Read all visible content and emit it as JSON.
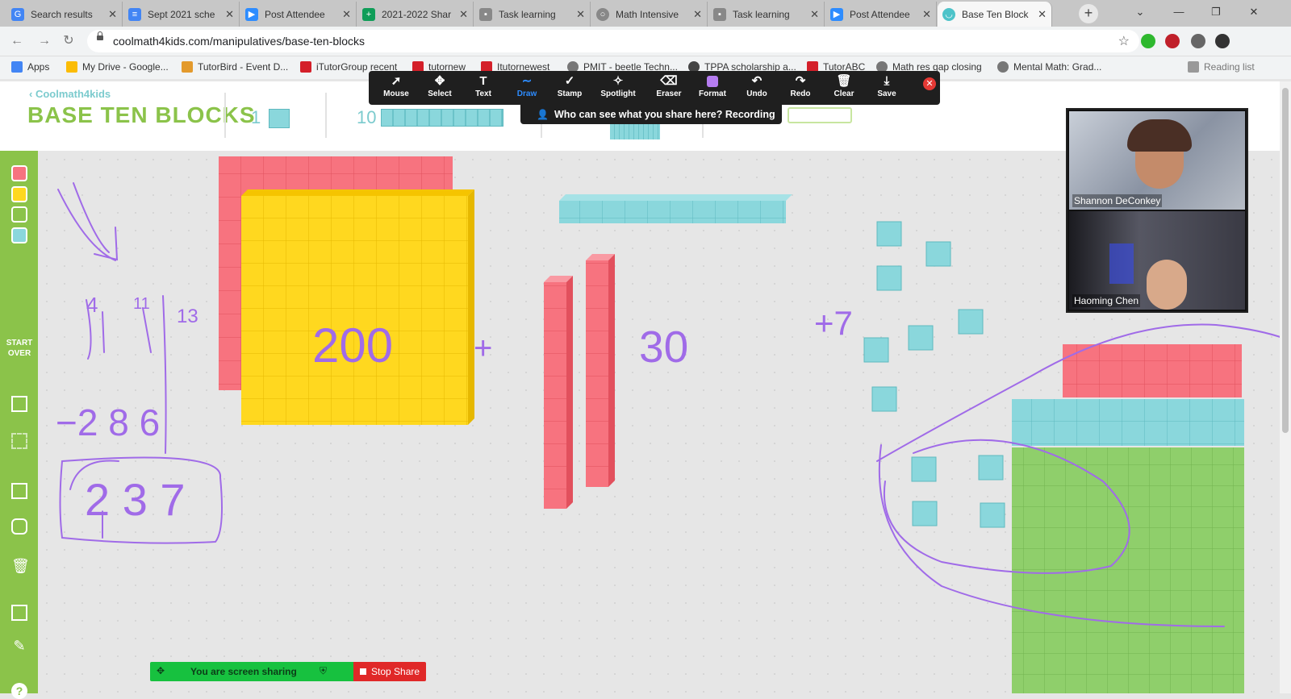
{
  "browser": {
    "tabs": [
      {
        "title": "Search results",
        "icon_color": "#4285f4"
      },
      {
        "title": "Sept 2021 sche",
        "icon_color": "#4285f4"
      },
      {
        "title": "Post Attendee",
        "icon_color": "#2d8cff"
      },
      {
        "title": "2021-2022 Shar",
        "icon_color": "#0f9d58"
      },
      {
        "title": "Task learning",
        "icon_color": "#777777"
      },
      {
        "title": "Math Intensive",
        "icon_color": "#777777"
      },
      {
        "title": "Task learning",
        "icon_color": "#777777"
      },
      {
        "title": "Post Attendee",
        "icon_color": "#2d8cff"
      },
      {
        "title": "Base Ten Block",
        "icon_color": "#4dc3c9"
      }
    ],
    "url": "coolmath4kids.com/manipulatives/base-ten-blocks",
    "bookmarks": [
      "Apps",
      "My Drive - Google...",
      "TutorBird - Event D...",
      "iTutorGroup recent",
      "tutornew",
      "Itutornewest",
      "PMIT - beetle Techn...",
      "TPPA scholarship a...",
      "TutorABC",
      "Math res gap closing",
      "Mental Math: Grad..."
    ],
    "reading_list": "Reading list"
  },
  "app": {
    "brand_small": "Coolmath4kids",
    "title": "BASE TEN BLOCKS",
    "block_1_label": "1",
    "block_10_label": "10",
    "start_over": "START OVER"
  },
  "zoom": {
    "tools": [
      "Mouse",
      "Select",
      "Text",
      "Draw",
      "Stamp",
      "Spotlight",
      "Eraser",
      "Format",
      "Undo",
      "Redo",
      "Clear",
      "Save"
    ],
    "active_tool": "Draw",
    "banner": "Who can see what you share here? Recording On",
    "participants": [
      "Shannon DeConkey",
      "Haoming Chen"
    ],
    "sharing_text": "You are screen sharing",
    "stop_share": "Stop Share"
  },
  "annotations": {
    "n200": "200",
    "plus": "+",
    "n30": "30",
    "plus7": "+7",
    "top_digits": [
      "4",
      "11",
      "13"
    ],
    "minus_row": "−2 8 6",
    "answer": "2 3 7"
  },
  "colors": {
    "red_block": "#f7737f",
    "yellow_block": "#ffd81f",
    "cyan_block": "#8ad7dc",
    "green_block": "#8fcf6b",
    "ink": "#a06be8",
    "sidebar": "#8bc34a"
  }
}
